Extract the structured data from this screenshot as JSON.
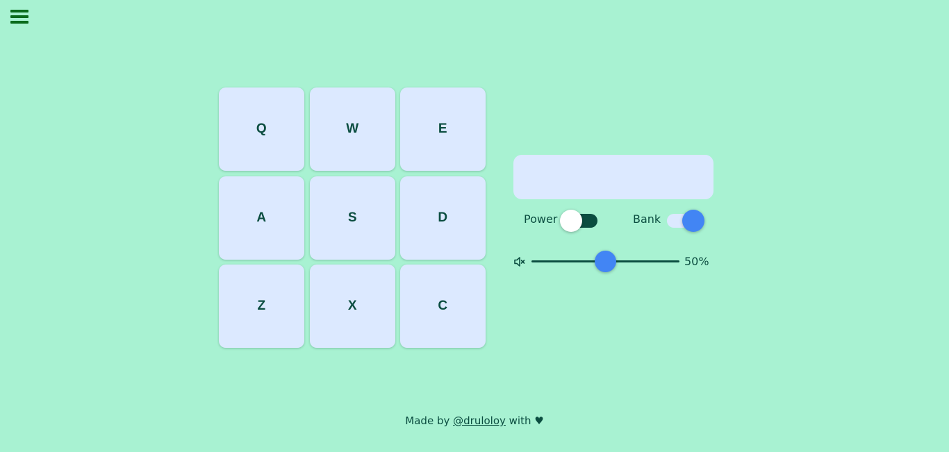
{
  "menu": {
    "icon": "hamburger-menu-icon"
  },
  "pads": [
    {
      "key": "Q"
    },
    {
      "key": "W"
    },
    {
      "key": "E"
    },
    {
      "key": "A"
    },
    {
      "key": "S"
    },
    {
      "key": "D"
    },
    {
      "key": "Z"
    },
    {
      "key": "X"
    },
    {
      "key": "C"
    }
  ],
  "display": {
    "text": ""
  },
  "controls": {
    "power_label": "Power",
    "power_on": false,
    "bank_label": "Bank",
    "bank_on": true,
    "volume_icon": "volume-mute-icon",
    "volume_fraction": 0.5,
    "volume_text": "50%"
  },
  "footer": {
    "prefix": "Made by ",
    "author": "@druloloy",
    "suffix": " with ♥"
  },
  "colors": {
    "background": "#a8f2d2",
    "pad": "#dce9ff",
    "text": "#0b4d40",
    "accent": "#4285f4",
    "menu": "#0a6b1c"
  }
}
